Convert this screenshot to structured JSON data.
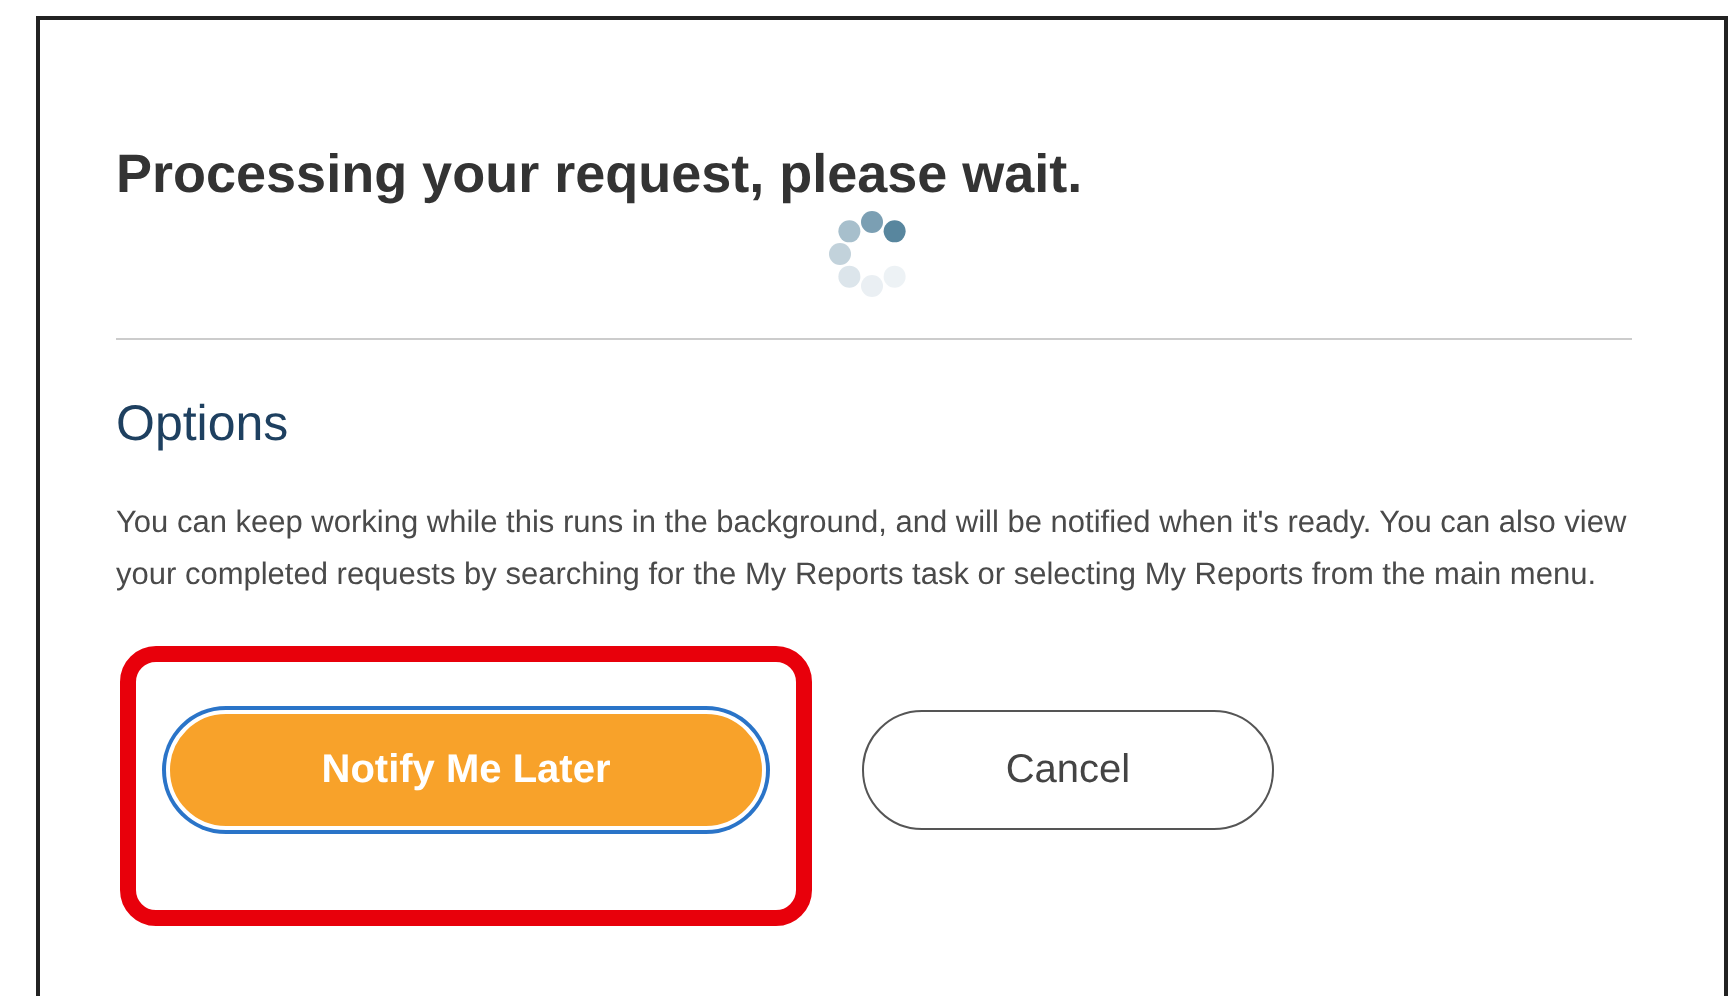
{
  "title": "Processing your request, please wait.",
  "options": {
    "heading": "Options",
    "text": "You can keep working while this runs in the background, and will be notified when it's ready. You can also view your completed requests by searching for the My Reports task or selecting My Reports from the main menu."
  },
  "buttons": [
    {
      "label": "Notify Me Later",
      "kind": "primary",
      "focused": true,
      "highlighted": true
    },
    {
      "label": "Cancel",
      "kind": "secondary",
      "focused": false,
      "highlighted": false
    }
  ]
}
